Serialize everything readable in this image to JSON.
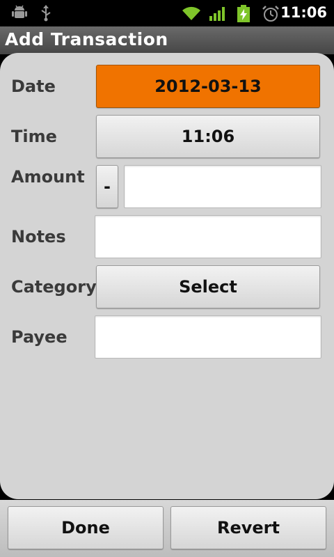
{
  "status_bar": {
    "time": "11:06",
    "icons": [
      "android-debug-icon",
      "usb-icon",
      "wifi-icon",
      "signal-icon",
      "battery-charging-icon",
      "alarm-icon"
    ]
  },
  "title_bar": {
    "title": "Add Transaction"
  },
  "form": {
    "date_label": "Date",
    "date_value": "2012-03-13",
    "time_label": "Time",
    "time_value": "11:06",
    "amount_label": "Amount",
    "amount_sign": "-",
    "amount_value": "",
    "notes_label": "Notes",
    "notes_value": "",
    "category_label": "Category",
    "category_value": "Select",
    "payee_label": "Payee",
    "payee_value": ""
  },
  "actions": {
    "done_label": "Done",
    "revert_label": "Revert"
  },
  "colors": {
    "accent": "#f07300",
    "panel": "#d4d4d4",
    "title_bar": "#555555"
  }
}
